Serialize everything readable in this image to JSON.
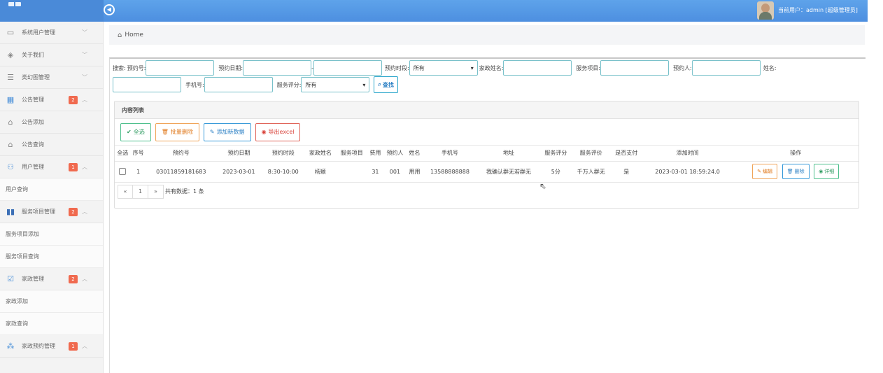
{
  "header": {
    "toggle_icon": "circle-arrow-icon",
    "user_label": "当前用户：admin [超级管理员]"
  },
  "sidebar": {
    "items": [
      {
        "label": "系统用户管理",
        "icon": "monitor-icon",
        "chevron": "﹀"
      },
      {
        "label": "关于我们",
        "icon": "globe-icon",
        "chevron": "﹀"
      },
      {
        "label": "类幻图管理",
        "icon": "list-icon",
        "chevron": "﹀"
      },
      {
        "label": "公告管理",
        "icon": "grid-icon",
        "badge": "2",
        "chevron": "︿"
      },
      {
        "label": "公告添加",
        "icon": "home-icon"
      },
      {
        "label": "公告查询",
        "icon": "home-icon"
      },
      {
        "label": "用户管理",
        "icon": "users-icon",
        "badge": "1",
        "chevron": "︿"
      },
      {
        "label": "用户查询"
      },
      {
        "label": "服务项目管理",
        "icon": "map-icon",
        "badge": "2",
        "chevron": "︿"
      },
      {
        "label": "服务项目添加"
      },
      {
        "label": "服务项目查询"
      },
      {
        "label": "家政管理",
        "icon": "check-icon",
        "badge": "2",
        "chevron": "︿"
      },
      {
        "label": "家政添加"
      },
      {
        "label": "家政查询"
      },
      {
        "label": "家政预约管理",
        "icon": "magic-icon",
        "badge": "1",
        "chevron": "︿"
      }
    ]
  },
  "breadcrumb": {
    "home_label": "Home"
  },
  "search": {
    "prefix": "搜索:",
    "order_no_label": "预约号:",
    "date_label": "预约日期:",
    "date_sep": "-",
    "period_label": "预约时段:",
    "period_value": "所有",
    "housekeeper_label": "家政姓名:",
    "service_label": "服务项目:",
    "booker_label": "预约人:",
    "name_label": "姓名:",
    "phone_label": "手机号:",
    "rating_label": "服务评分:",
    "rating_value": "所有",
    "search_button": "查找"
  },
  "panel": {
    "title": "内容列表",
    "select_all": "全选",
    "batch_delete": "批量删除",
    "add_new": "添加新数据",
    "export": "导出excel"
  },
  "table": {
    "columns": [
      "全选",
      "序号",
      "预约号",
      "预约日期",
      "预约时段",
      "家政姓名",
      "服务项目",
      "费用",
      "预约人",
      "姓名",
      "手机号",
      "地址",
      "服务评分",
      "服务评价",
      "是否支付",
      "添加时间",
      "操作"
    ],
    "rows": [
      {
        "index": "1",
        "order_no": "03011859181683",
        "date": "2023-03-01",
        "period": "8:30-10:00",
        "housekeeper": "杨颖",
        "service": "",
        "fee": "31",
        "booker": "001",
        "name": "用用",
        "phone": "13588888888",
        "address": "我确认群无若群无",
        "rating": "5分",
        "review": "千万人群无",
        "paid": "是",
        "created": "2023-03-01 18:59:24.0",
        "edit": "编辑",
        "delete": "删除",
        "detail": "详细"
      }
    ]
  },
  "pager": {
    "prev": "«",
    "page": "1",
    "next": "»",
    "total": "共有数据：1 条"
  },
  "colors": {
    "topbar": "#4d8fe0",
    "badge": "#f06a4f",
    "input_border": "#79c1ca"
  }
}
